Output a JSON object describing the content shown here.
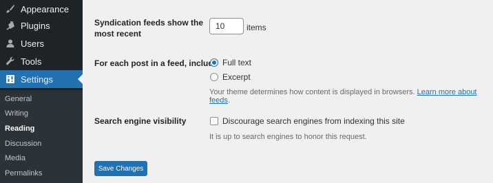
{
  "menu": {
    "appearance": "Appearance",
    "plugins": "Plugins",
    "users": "Users",
    "tools": "Tools",
    "settings": "Settings"
  },
  "submenu": {
    "general": "General",
    "writing": "Writing",
    "reading": "Reading",
    "discussion": "Discussion",
    "media": "Media",
    "permalinks": "Permalinks"
  },
  "syndication": {
    "label_line1": "Syndication feeds show the",
    "label_line2": "most recent",
    "value": "10",
    "unit": "items"
  },
  "feed_content": {
    "label": "For each post in a feed, include",
    "option_full": "Full text",
    "option_excerpt": "Excerpt",
    "selected": "Full text",
    "description": "Your theme determines how content is displayed in browsers.",
    "link": "Learn more about feeds"
  },
  "search_visibility": {
    "label": "Search engine visibility",
    "checkbox_label": "Discourage search engines from indexing this site",
    "checked": false,
    "description": "It is up to search engines to honor this request."
  },
  "save_button": "Save Changes",
  "colors": {
    "sidebar": "#1d2327",
    "submenu": "#2c3338",
    "accent": "#2271b1",
    "background": "#f0f0f1"
  }
}
